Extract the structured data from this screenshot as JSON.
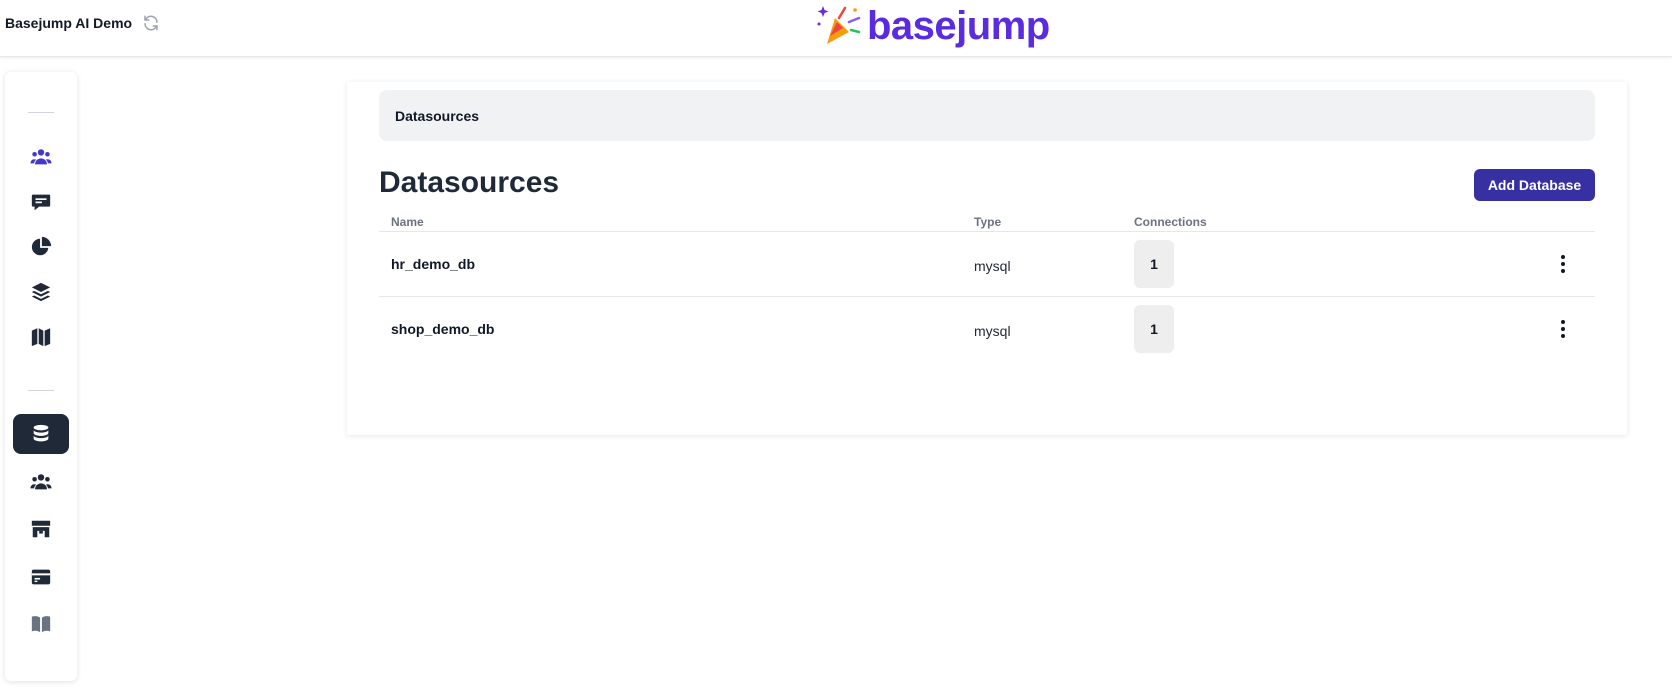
{
  "header": {
    "org_name": "Basejump AI Demo",
    "logo_text": "basejump",
    "brand_color": "#5b2be0"
  },
  "sidebar": {
    "active_color": "#1f2937",
    "items": [
      {
        "icon": "users-icon"
      },
      {
        "icon": "chat-icon"
      },
      {
        "icon": "pie-chart-icon"
      },
      {
        "icon": "layers-icon"
      },
      {
        "icon": "map-icon"
      },
      {
        "icon": "database-icon",
        "active": true
      },
      {
        "icon": "team-icon"
      },
      {
        "icon": "store-icon"
      },
      {
        "icon": "credit-card-icon"
      },
      {
        "icon": "book-icon"
      }
    ]
  },
  "main": {
    "breadcrumb": "Datasources",
    "title": "Datasources",
    "add_button": "Add Database",
    "columns": {
      "name": "Name",
      "type": "Type",
      "connections": "Connections"
    },
    "rows": [
      {
        "name": "hr_demo_db",
        "type": "mysql",
        "connections": "1"
      },
      {
        "name": "shop_demo_db",
        "type": "mysql",
        "connections": "1"
      }
    ]
  }
}
